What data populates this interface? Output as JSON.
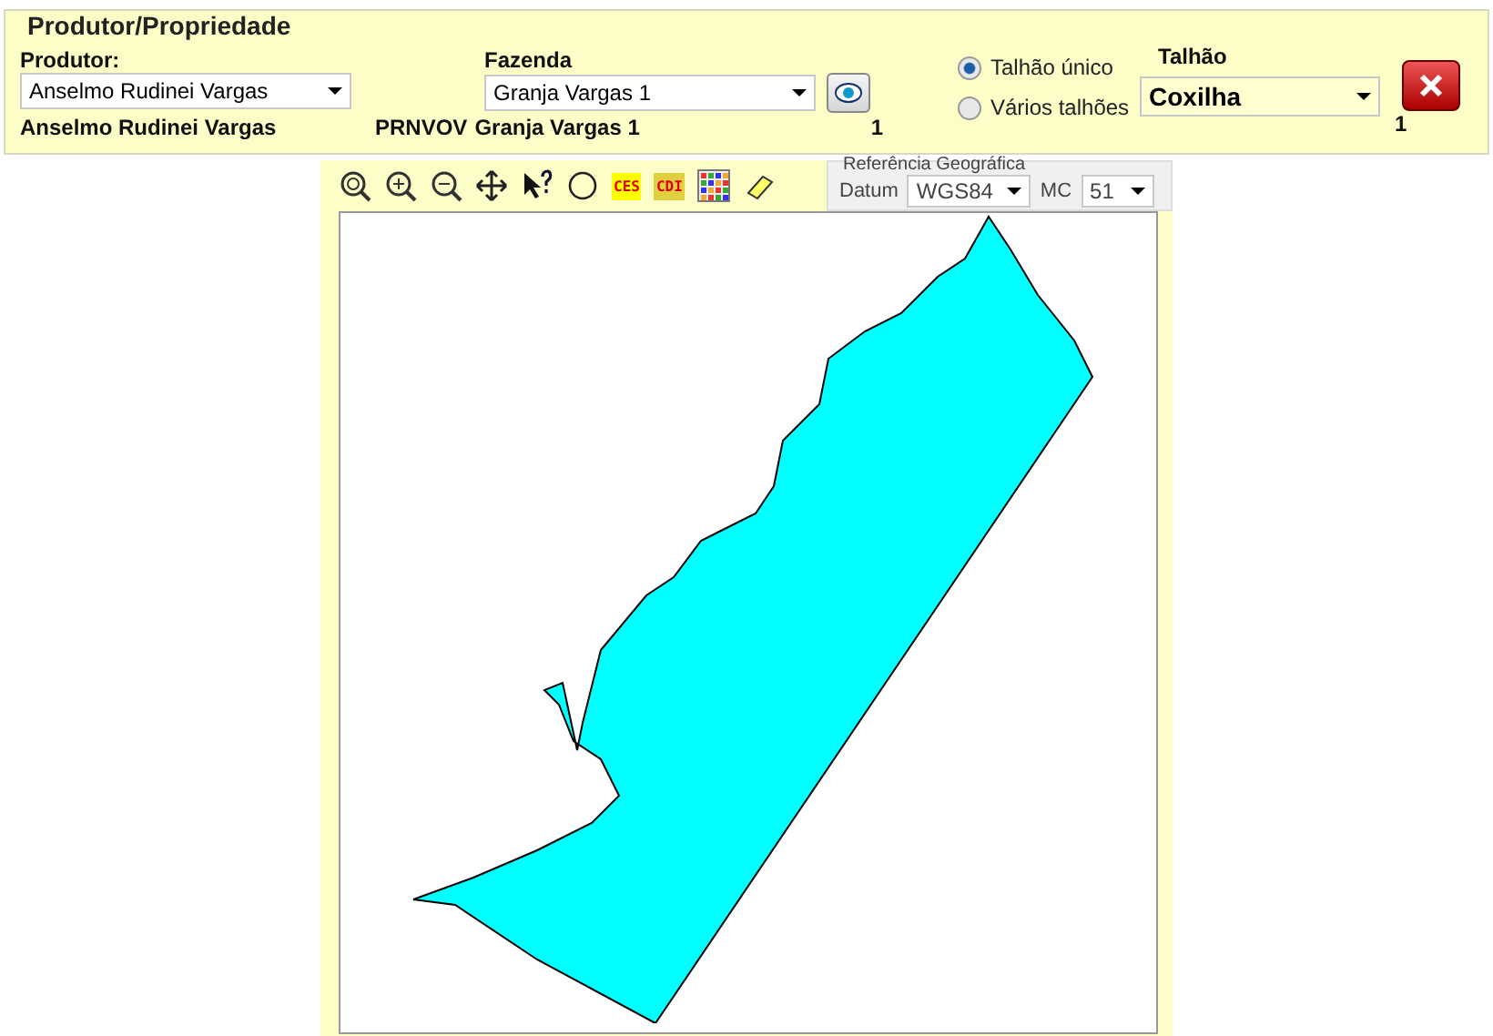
{
  "header": {
    "title": "Produtor/Propriedade",
    "produtor_label": "Produtor:",
    "produtor_value": "Anselmo Rudinei Vargas",
    "produtor_name": "Anselmo Rudinei Vargas",
    "fazenda_label": "Fazenda",
    "fazenda_value": "Granja Vargas 1",
    "fazenda_code": "PRNVOV",
    "fazenda_name": "Granja Vargas 1",
    "fazenda_count": "1"
  },
  "radios": [
    {
      "label": "Talhão único",
      "selected": true
    },
    {
      "label": "Vários talhões",
      "selected": false
    }
  ],
  "talhao": {
    "label": "Talhão",
    "value": "Coxilha",
    "count": "1"
  },
  "toolbar": {
    "tools": [
      {
        "kind": "zoom"
      },
      {
        "kind": "zoom-in"
      },
      {
        "kind": "zoom-out"
      },
      {
        "kind": "pan"
      },
      {
        "kind": "info"
      },
      {
        "kind": "circle"
      },
      {
        "kind": "tag",
        "text": "CES",
        "color": "#ffff00"
      },
      {
        "kind": "tag",
        "text": "CDI",
        "color": "#e0d040"
      },
      {
        "kind": "palette"
      },
      {
        "kind": "eraser"
      }
    ]
  },
  "geo": {
    "title": "Referência Geográfica",
    "datum_label": "Datum",
    "datum_value": "WGS84",
    "mc_label": "MC",
    "mc_value": "51"
  }
}
